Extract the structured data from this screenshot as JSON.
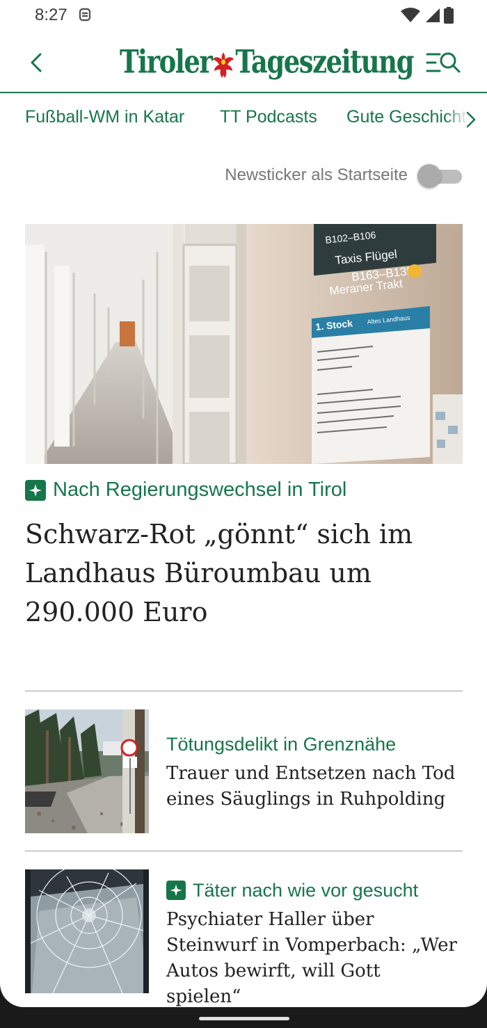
{
  "status_bar": {
    "time": "8:27"
  },
  "app_bar": {
    "logo_left": "Tiroler",
    "logo_right": "Tageszeitung",
    "brand_color": "#16764a"
  },
  "categories": [
    "Fußball-WM in Katar",
    "TT Podcasts",
    "Gute Geschichten"
  ],
  "newsticker": {
    "label": "Newsticker als Startseite",
    "enabled": false
  },
  "lead_story": {
    "kicker": "Nach Regierungswechsel in Tirol",
    "premium": true,
    "title": "Schwarz-Rot „gönnt“ sich im Landhaus Büroumbau um 290.000 Euro",
    "image_signs": {
      "line1": "B102–B106",
      "line2": "Taxis Flügel",
      "line3": "B163–B135",
      "line4": "Meraner Trakt",
      "floor": "1. Stock",
      "wing": "Altes Landhaus"
    }
  },
  "stories": [
    {
      "kicker": "Tötungsdelikt in Grenznähe",
      "premium": false,
      "title": "Trauer und Entsetzen nach Tod eines Säuglings in Ruhpolding"
    },
    {
      "kicker": "Täter nach wie vor gesucht",
      "premium": true,
      "title": "Psychiater Haller über Steinwurf in Vomperbach: „Wer Autos bewirft, will Gott spielen“"
    }
  ]
}
